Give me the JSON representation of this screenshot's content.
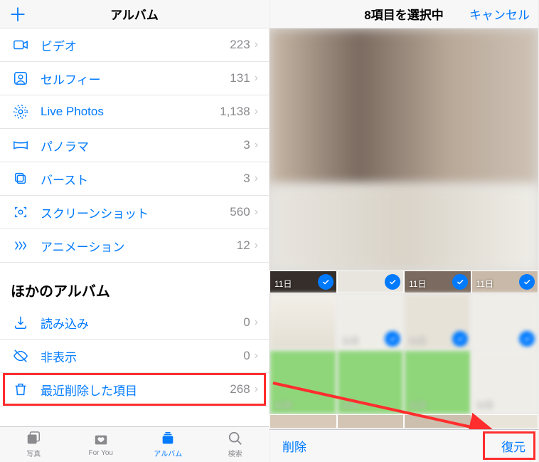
{
  "left": {
    "navTitle": "アルバム",
    "addSymbol": "＋",
    "mediaTypes": [
      {
        "icon": "video",
        "label": "ビデオ",
        "count": "223"
      },
      {
        "icon": "selfie",
        "label": "セルフィー",
        "count": "131"
      },
      {
        "icon": "live",
        "label": "Live Photos",
        "count": "1,138"
      },
      {
        "icon": "pano",
        "label": "パノラマ",
        "count": "3"
      },
      {
        "icon": "burst",
        "label": "バースト",
        "count": "3"
      },
      {
        "icon": "screenshot",
        "label": "スクリーンショット",
        "count": "560"
      },
      {
        "icon": "anim",
        "label": "アニメーション",
        "count": "12"
      }
    ],
    "otherHeader": "ほかのアルバム",
    "otherAlbums": [
      {
        "icon": "import",
        "label": "読み込み",
        "count": "0"
      },
      {
        "icon": "hidden",
        "label": "非表示",
        "count": "0"
      },
      {
        "icon": "trash",
        "label": "最近削除した項目",
        "count": "268",
        "highlighted": true
      }
    ],
    "tabs": [
      {
        "label": "写真"
      },
      {
        "label": "For You"
      },
      {
        "label": "アルバム",
        "active": true
      },
      {
        "label": "検索"
      }
    ]
  },
  "right": {
    "navTitle": "8項目を選択中",
    "cancel": "キャンセル",
    "dayLabel": "11日",
    "delete": "削除",
    "recover": "復元"
  }
}
